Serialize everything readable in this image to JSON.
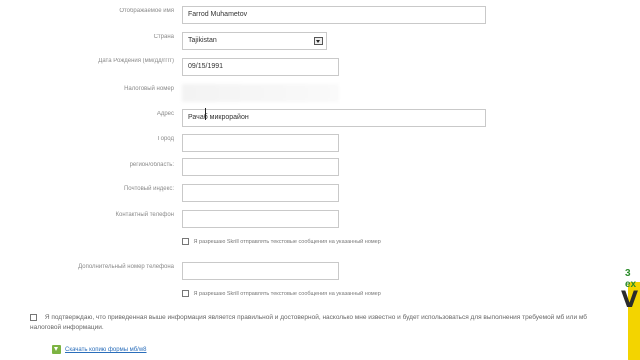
{
  "form": {
    "fullname_label": "Отображаемое имя",
    "fullname_value": "Farrod Muhametov",
    "country_label": "Страна",
    "country_value": "Tajikistan",
    "birthdate_label": "Дата Рождения (мм/дд/гггг)",
    "birthdate_value": "09/15/1991",
    "tax_label": "Налоговый номер",
    "address_label": "Адрес",
    "address_value": "Рачаб микрорайон",
    "city_label": "Город",
    "region_label": "регион/область:",
    "zip_label": "Почтовый индекс:",
    "phone_label": "Контактный телефон",
    "phone_sms_text": "Я разрешаю Skrill отправлять текстовые сообщения на указанный номер",
    "alt_phone_label": "Дополнительный номер телефона",
    "alt_phone_sms_text": "Я разрешаю Skrill отправлять текстовые сообщения на указанный номер"
  },
  "confirm": {
    "text": "Я подтверждаю, что приведенная выше информация является правильной и достоверной, насколько мне известно и будет использоваться для выполнения требуемой мб или мб налоговой информации."
  },
  "download": {
    "link_text": "Скачать копию формы мб/w8"
  },
  "logo": {
    "letter": "V",
    "top_text": "3 ex"
  },
  "colors": {
    "link": "#2a6ebb",
    "download_icon": "#7cb342",
    "logo_yellow": "#f3d400"
  }
}
